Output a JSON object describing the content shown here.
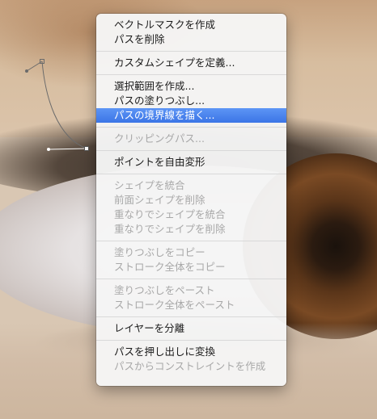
{
  "menu": {
    "items": [
      {
        "label": "ベクトルマスクを作成",
        "disabled": false,
        "selected": false
      },
      {
        "label": "パスを削除",
        "disabled": false,
        "selected": false
      },
      {
        "separator": true
      },
      {
        "label": "カスタムシェイプを定義...",
        "disabled": false,
        "selected": false
      },
      {
        "separator": true
      },
      {
        "label": "選択範囲を作成...",
        "disabled": false,
        "selected": false
      },
      {
        "label": "パスの塗りつぶし...",
        "disabled": false,
        "selected": false
      },
      {
        "label": "パスの境界線を描く...",
        "disabled": false,
        "selected": true
      },
      {
        "separator": true
      },
      {
        "label": "クリッピングパス...",
        "disabled": true,
        "selected": false
      },
      {
        "separator": true
      },
      {
        "label": "ポイントを自由変形",
        "disabled": false,
        "selected": false
      },
      {
        "separator": true
      },
      {
        "label": "シェイプを統合",
        "disabled": true,
        "selected": false
      },
      {
        "label": "前面シェイプを削除",
        "disabled": true,
        "selected": false
      },
      {
        "label": "重なりでシェイプを統合",
        "disabled": true,
        "selected": false
      },
      {
        "label": "重なりでシェイプを削除",
        "disabled": true,
        "selected": false
      },
      {
        "separator": true
      },
      {
        "label": "塗りつぶしをコピー",
        "disabled": true,
        "selected": false
      },
      {
        "label": "ストローク全体をコピー",
        "disabled": true,
        "selected": false
      },
      {
        "separator": true
      },
      {
        "label": "塗りつぶしをペースト",
        "disabled": true,
        "selected": false
      },
      {
        "label": "ストローク全体をペースト",
        "disabled": true,
        "selected": false
      },
      {
        "separator": true
      },
      {
        "label": "レイヤーを分離",
        "disabled": false,
        "selected": false
      },
      {
        "separator": true
      },
      {
        "label": "パスを押し出しに変換",
        "disabled": false,
        "selected": false
      },
      {
        "label": "パスからコンストレイントを作成",
        "disabled": true,
        "selected": false
      }
    ]
  }
}
